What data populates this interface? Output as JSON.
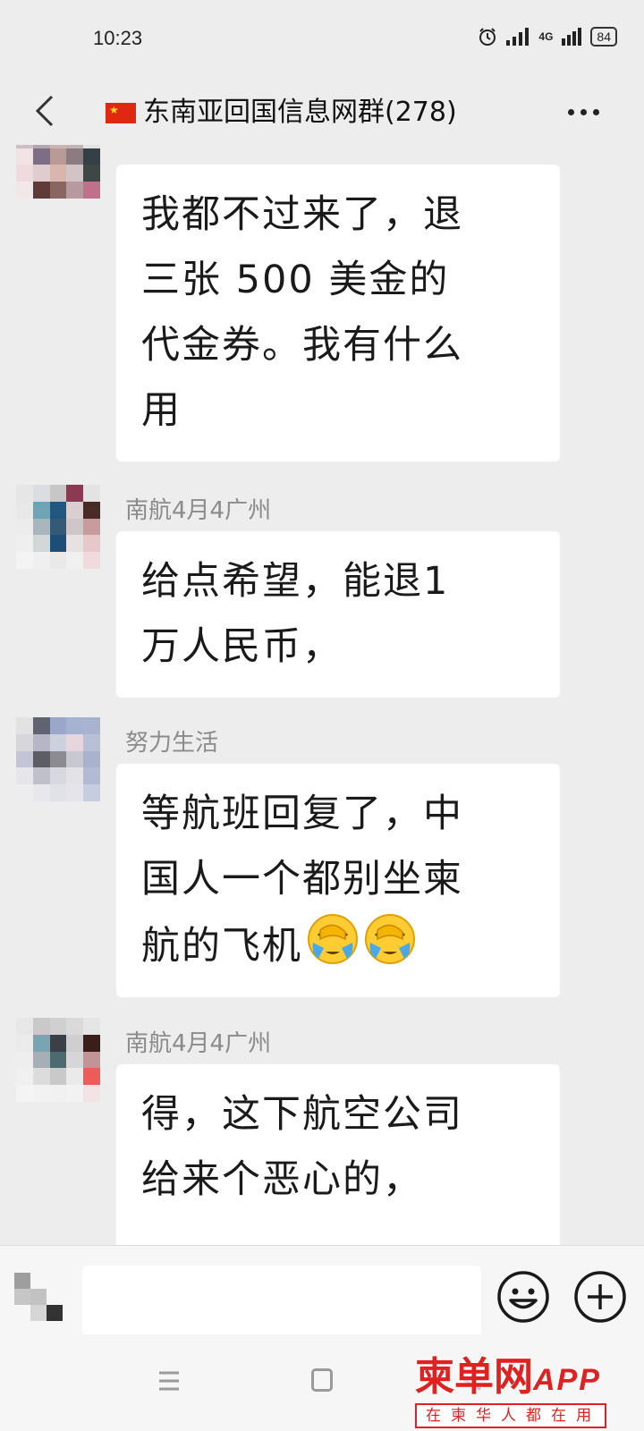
{
  "status_bar": {
    "time": "10:23",
    "network": "4G",
    "battery": "84"
  },
  "nav": {
    "flag_icon": "china-flag",
    "title": "东南亚回国信息网群(278)",
    "title_suffix": "",
    "back_icon": "chevron-left-icon",
    "more_icon": "more-dots-icon"
  },
  "messages": [
    {
      "sender": "",
      "lines": [
        "我都不过来了，退",
        "三张 500 美金的",
        "代金券。我有什么",
        "用"
      ]
    },
    {
      "sender": "南航4月4广州",
      "lines": [
        "给点希望，能退1",
        "万人民币，"
      ]
    },
    {
      "sender": "努力生活",
      "lines": [
        "等航班回复了，中",
        "国人一个都别坐柬",
        "航的飞机"
      ],
      "emoji": "face-palm-crying-emoji"
    },
    {
      "sender": "南航4月4广州",
      "lines": [
        "得，这下航空公司",
        "给来个恶心的，"
      ]
    }
  ],
  "input_bar": {
    "placeholder": "",
    "emoji_icon": "smiley-icon",
    "plus_icon": "plus-circle-icon"
  },
  "watermark": {
    "brand": "柬单网",
    "app": "APP",
    "slogan": "在柬华人都在用"
  },
  "colors": {
    "background": "#ededed",
    "bubble": "#ffffff",
    "sender_text": "#8b8b8b",
    "watermark_red": "#e02121"
  }
}
